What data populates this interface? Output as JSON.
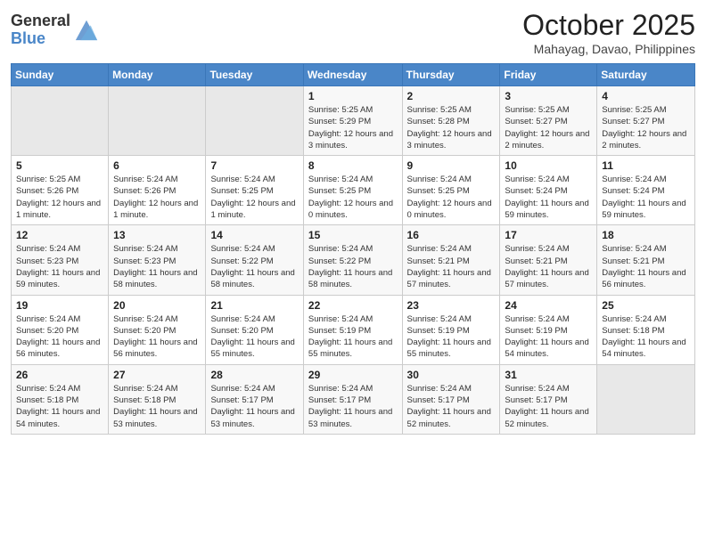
{
  "header": {
    "logo_line1": "General",
    "logo_line2": "Blue",
    "month": "October 2025",
    "location": "Mahayag, Davao, Philippines"
  },
  "weekdays": [
    "Sunday",
    "Monday",
    "Tuesday",
    "Wednesday",
    "Thursday",
    "Friday",
    "Saturday"
  ],
  "weeks": [
    [
      {
        "day": "",
        "sunrise": "",
        "sunset": "",
        "daylight": "",
        "empty": true
      },
      {
        "day": "",
        "sunrise": "",
        "sunset": "",
        "daylight": "",
        "empty": true
      },
      {
        "day": "",
        "sunrise": "",
        "sunset": "",
        "daylight": "",
        "empty": true
      },
      {
        "day": "1",
        "sunrise": "Sunrise: 5:25 AM",
        "sunset": "Sunset: 5:29 PM",
        "daylight": "Daylight: 12 hours and 3 minutes."
      },
      {
        "day": "2",
        "sunrise": "Sunrise: 5:25 AM",
        "sunset": "Sunset: 5:28 PM",
        "daylight": "Daylight: 12 hours and 3 minutes."
      },
      {
        "day": "3",
        "sunrise": "Sunrise: 5:25 AM",
        "sunset": "Sunset: 5:27 PM",
        "daylight": "Daylight: 12 hours and 2 minutes."
      },
      {
        "day": "4",
        "sunrise": "Sunrise: 5:25 AM",
        "sunset": "Sunset: 5:27 PM",
        "daylight": "Daylight: 12 hours and 2 minutes."
      }
    ],
    [
      {
        "day": "5",
        "sunrise": "Sunrise: 5:25 AM",
        "sunset": "Sunset: 5:26 PM",
        "daylight": "Daylight: 12 hours and 1 minute."
      },
      {
        "day": "6",
        "sunrise": "Sunrise: 5:24 AM",
        "sunset": "Sunset: 5:26 PM",
        "daylight": "Daylight: 12 hours and 1 minute."
      },
      {
        "day": "7",
        "sunrise": "Sunrise: 5:24 AM",
        "sunset": "Sunset: 5:25 PM",
        "daylight": "Daylight: 12 hours and 1 minute."
      },
      {
        "day": "8",
        "sunrise": "Sunrise: 5:24 AM",
        "sunset": "Sunset: 5:25 PM",
        "daylight": "Daylight: 12 hours and 0 minutes."
      },
      {
        "day": "9",
        "sunrise": "Sunrise: 5:24 AM",
        "sunset": "Sunset: 5:25 PM",
        "daylight": "Daylight: 12 hours and 0 minutes."
      },
      {
        "day": "10",
        "sunrise": "Sunrise: 5:24 AM",
        "sunset": "Sunset: 5:24 PM",
        "daylight": "Daylight: 11 hours and 59 minutes."
      },
      {
        "day": "11",
        "sunrise": "Sunrise: 5:24 AM",
        "sunset": "Sunset: 5:24 PM",
        "daylight": "Daylight: 11 hours and 59 minutes."
      }
    ],
    [
      {
        "day": "12",
        "sunrise": "Sunrise: 5:24 AM",
        "sunset": "Sunset: 5:23 PM",
        "daylight": "Daylight: 11 hours and 59 minutes."
      },
      {
        "day": "13",
        "sunrise": "Sunrise: 5:24 AM",
        "sunset": "Sunset: 5:23 PM",
        "daylight": "Daylight: 11 hours and 58 minutes."
      },
      {
        "day": "14",
        "sunrise": "Sunrise: 5:24 AM",
        "sunset": "Sunset: 5:22 PM",
        "daylight": "Daylight: 11 hours and 58 minutes."
      },
      {
        "day": "15",
        "sunrise": "Sunrise: 5:24 AM",
        "sunset": "Sunset: 5:22 PM",
        "daylight": "Daylight: 11 hours and 58 minutes."
      },
      {
        "day": "16",
        "sunrise": "Sunrise: 5:24 AM",
        "sunset": "Sunset: 5:21 PM",
        "daylight": "Daylight: 11 hours and 57 minutes."
      },
      {
        "day": "17",
        "sunrise": "Sunrise: 5:24 AM",
        "sunset": "Sunset: 5:21 PM",
        "daylight": "Daylight: 11 hours and 57 minutes."
      },
      {
        "day": "18",
        "sunrise": "Sunrise: 5:24 AM",
        "sunset": "Sunset: 5:21 PM",
        "daylight": "Daylight: 11 hours and 56 minutes."
      }
    ],
    [
      {
        "day": "19",
        "sunrise": "Sunrise: 5:24 AM",
        "sunset": "Sunset: 5:20 PM",
        "daylight": "Daylight: 11 hours and 56 minutes."
      },
      {
        "day": "20",
        "sunrise": "Sunrise: 5:24 AM",
        "sunset": "Sunset: 5:20 PM",
        "daylight": "Daylight: 11 hours and 56 minutes."
      },
      {
        "day": "21",
        "sunrise": "Sunrise: 5:24 AM",
        "sunset": "Sunset: 5:20 PM",
        "daylight": "Daylight: 11 hours and 55 minutes."
      },
      {
        "day": "22",
        "sunrise": "Sunrise: 5:24 AM",
        "sunset": "Sunset: 5:19 PM",
        "daylight": "Daylight: 11 hours and 55 minutes."
      },
      {
        "day": "23",
        "sunrise": "Sunrise: 5:24 AM",
        "sunset": "Sunset: 5:19 PM",
        "daylight": "Daylight: 11 hours and 55 minutes."
      },
      {
        "day": "24",
        "sunrise": "Sunrise: 5:24 AM",
        "sunset": "Sunset: 5:19 PM",
        "daylight": "Daylight: 11 hours and 54 minutes."
      },
      {
        "day": "25",
        "sunrise": "Sunrise: 5:24 AM",
        "sunset": "Sunset: 5:18 PM",
        "daylight": "Daylight: 11 hours and 54 minutes."
      }
    ],
    [
      {
        "day": "26",
        "sunrise": "Sunrise: 5:24 AM",
        "sunset": "Sunset: 5:18 PM",
        "daylight": "Daylight: 11 hours and 54 minutes."
      },
      {
        "day": "27",
        "sunrise": "Sunrise: 5:24 AM",
        "sunset": "Sunset: 5:18 PM",
        "daylight": "Daylight: 11 hours and 53 minutes."
      },
      {
        "day": "28",
        "sunrise": "Sunrise: 5:24 AM",
        "sunset": "Sunset: 5:17 PM",
        "daylight": "Daylight: 11 hours and 53 minutes."
      },
      {
        "day": "29",
        "sunrise": "Sunrise: 5:24 AM",
        "sunset": "Sunset: 5:17 PM",
        "daylight": "Daylight: 11 hours and 53 minutes."
      },
      {
        "day": "30",
        "sunrise": "Sunrise: 5:24 AM",
        "sunset": "Sunset: 5:17 PM",
        "daylight": "Daylight: 11 hours and 52 minutes."
      },
      {
        "day": "31",
        "sunrise": "Sunrise: 5:24 AM",
        "sunset": "Sunset: 5:17 PM",
        "daylight": "Daylight: 11 hours and 52 minutes."
      },
      {
        "day": "",
        "sunrise": "",
        "sunset": "",
        "daylight": "",
        "empty": true
      }
    ]
  ]
}
